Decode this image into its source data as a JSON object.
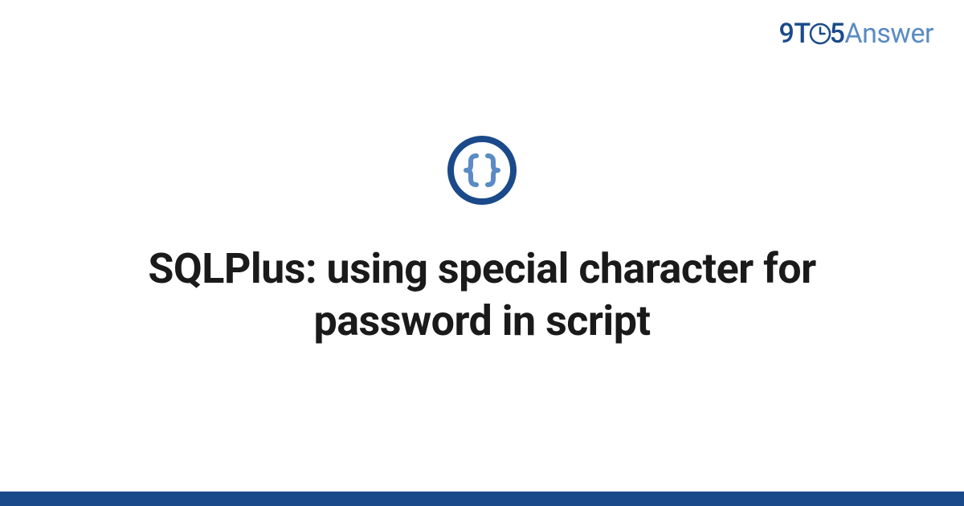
{
  "brand": {
    "part1": "9T",
    "part2": "5",
    "part3": "Answer"
  },
  "icon": {
    "name": "code-braces-icon",
    "ring_color": "#1a4a8a",
    "brace_color": "#5a8bc4"
  },
  "title": "SQLPlus: using special character for password in script",
  "colors": {
    "footer_bar": "#1a4a8a"
  }
}
